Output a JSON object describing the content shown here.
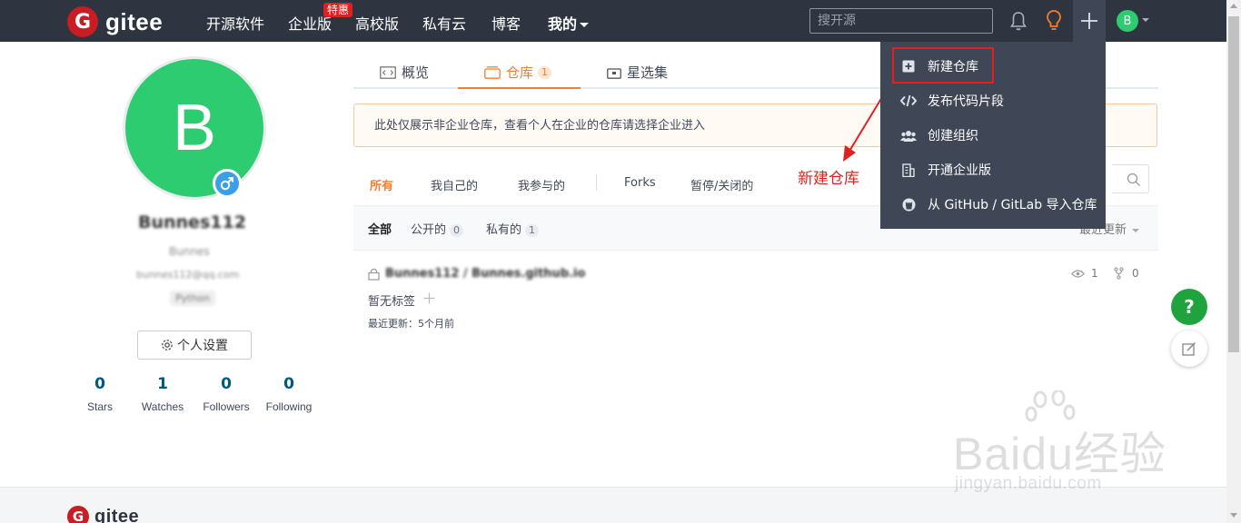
{
  "header": {
    "logo_letter": "G",
    "logo_text": "gitee",
    "nav": [
      "开源软件",
      "企业版",
      "高校版",
      "私有云",
      "博客",
      "我的"
    ],
    "hot_badge": "特惠",
    "search_placeholder": "搜开源",
    "avatar_letter": "B",
    "icons": [
      "bell-icon",
      "lightbulb-icon",
      "plus-icon",
      "chevron-down-icon"
    ]
  },
  "profile": {
    "avatar_letter": "B",
    "name": "Bunnes112",
    "username": "Bunnes",
    "email": "bunnes112@qq.com",
    "tag": "Python",
    "settings_label": "个人设置",
    "stats": [
      {
        "value": "0",
        "label": "Stars"
      },
      {
        "value": "1",
        "label": "Watches"
      },
      {
        "value": "0",
        "label": "Followers"
      },
      {
        "value": "0",
        "label": "Following"
      }
    ]
  },
  "tabs": [
    {
      "label": "概览",
      "icon": "code-icon"
    },
    {
      "label": "仓库",
      "count": "1",
      "icon": "box-icon",
      "active": true
    },
    {
      "label": "星选集",
      "icon": "star-box-icon"
    }
  ],
  "notice": "此处仅展示非企业仓库，查看个人在企业的仓库请选择企业进入",
  "filters": [
    "所有",
    "我自己的",
    "我参与的",
    "Forks",
    "暂停/关闭的"
  ],
  "subfilters": [
    {
      "label": "全部"
    },
    {
      "label": "公开的",
      "count": "0"
    },
    {
      "label": "私有的",
      "count": "1"
    }
  ],
  "sort_label": "最近更新",
  "repo": {
    "name": "Bunnes112 / Bunnes.github.io",
    "tags": "暂无标签",
    "updated": "最近更新：5个月前",
    "watch_count": "1",
    "fork_count": "0"
  },
  "annotation": "新建仓库",
  "dropdown": [
    {
      "label": "新建仓库",
      "icon": "plus-square-icon"
    },
    {
      "label": "发布代码片段",
      "icon": "code-icon"
    },
    {
      "label": "创建组织",
      "icon": "users-icon"
    },
    {
      "label": "开通企业版",
      "icon": "building-icon"
    },
    {
      "label": "从 GitHub / GitLab 导入仓库",
      "icon": "github-icon"
    }
  ],
  "float": {
    "help": "?"
  },
  "footer": {
    "logo_text": "gitee"
  },
  "watermark": {
    "main": "Baidu经验",
    "sub": "jingyan.baidu.com"
  },
  "colors": {
    "brand": "#c71d23",
    "accent": "#f57d2f",
    "topbar": "#2e3440",
    "green": "#2ecc71",
    "link": "#005980"
  }
}
